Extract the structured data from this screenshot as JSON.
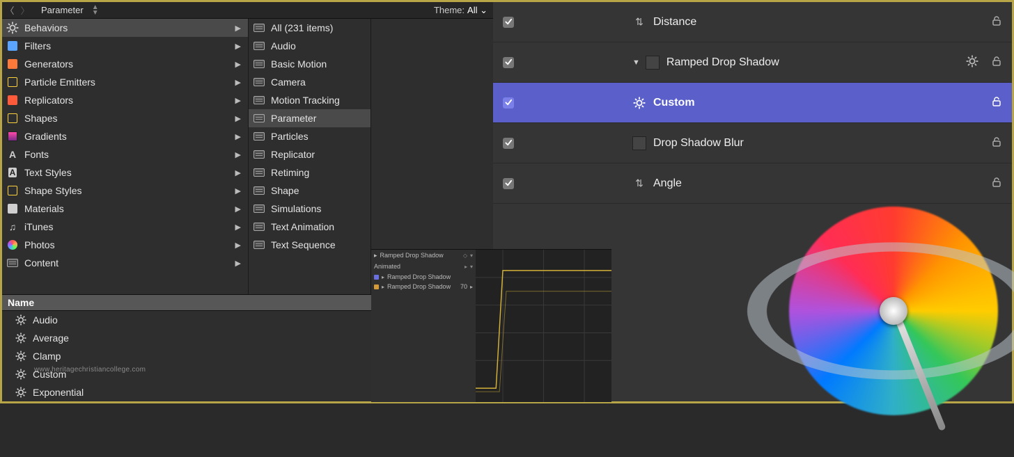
{
  "browser": {
    "path": "Parameter",
    "theme_label": "Theme:",
    "theme_value": "All",
    "categories": [
      {
        "icon": "gear",
        "label": "Behaviors",
        "selected": true
      },
      {
        "icon": "filters",
        "label": "Filters",
        "selected": false
      },
      {
        "icon": "gen",
        "label": "Generators",
        "selected": false
      },
      {
        "icon": "particle",
        "label": "Particle Emitters",
        "selected": false
      },
      {
        "icon": "repl",
        "label": "Replicators",
        "selected": false
      },
      {
        "icon": "shape",
        "label": "Shapes",
        "selected": false
      },
      {
        "icon": "grad",
        "label": "Gradients",
        "selected": false
      },
      {
        "icon": "font",
        "label": "Fonts",
        "selected": false
      },
      {
        "icon": "tstyle",
        "label": "Text Styles",
        "selected": false
      },
      {
        "icon": "sstyle",
        "label": "Shape Styles",
        "selected": false
      },
      {
        "icon": "mat",
        "label": "Materials",
        "selected": false
      },
      {
        "icon": "itunes",
        "label": "iTunes",
        "selected": false
      },
      {
        "icon": "photos",
        "label": "Photos",
        "selected": false
      },
      {
        "icon": "folder",
        "label": "Content",
        "selected": false
      }
    ],
    "subcats": [
      {
        "label": "All (231 items)",
        "selected": false
      },
      {
        "label": "Audio",
        "selected": false
      },
      {
        "label": "Basic Motion",
        "selected": false
      },
      {
        "label": "Camera",
        "selected": false
      },
      {
        "label": "Motion Tracking",
        "selected": false
      },
      {
        "label": "Parameter",
        "selected": true
      },
      {
        "label": "Particles",
        "selected": false
      },
      {
        "label": "Replicator",
        "selected": false
      },
      {
        "label": "Retiming",
        "selected": false
      },
      {
        "label": "Shape",
        "selected": false
      },
      {
        "label": "Simulations",
        "selected": false
      },
      {
        "label": "Text Animation",
        "selected": false
      },
      {
        "label": "Text Sequence",
        "selected": false
      }
    ],
    "name_header": "Name",
    "items": [
      {
        "label": "Audio"
      },
      {
        "label": "Average"
      },
      {
        "label": "Clamp"
      },
      {
        "label": "Custom"
      },
      {
        "label": "Exponential"
      }
    ]
  },
  "layers": [
    {
      "checked": true,
      "disc": "",
      "thumb": "adj",
      "gearIcon": false,
      "name": "Distance",
      "gear": false,
      "selected": false
    },
    {
      "checked": true,
      "disc": "▼",
      "thumb": "box",
      "gearIcon": false,
      "name": "Ramped Drop Shadow",
      "gear": true,
      "selected": false
    },
    {
      "checked": true,
      "disc": "",
      "thumb": "gear",
      "gearIcon": true,
      "name": "Custom",
      "gear": false,
      "selected": true
    },
    {
      "checked": true,
      "disc": "",
      "thumb": "box",
      "gearIcon": false,
      "name": "Drop Shadow Blur",
      "gear": false,
      "selected": false
    },
    {
      "checked": true,
      "disc": "",
      "thumb": "adj",
      "gearIcon": false,
      "name": "Angle",
      "gear": false,
      "selected": false
    }
  ],
  "keyframe": {
    "title": "Ramped Drop Shadow",
    "mode": "Animated",
    "tracks": [
      {
        "color": "blue",
        "label": "Ramped Drop Shadow",
        "value": ""
      },
      {
        "color": "orange",
        "label": "Ramped Drop Shadow",
        "value": "70"
      }
    ]
  },
  "watermark": "www.heritagechristiancollege.com"
}
